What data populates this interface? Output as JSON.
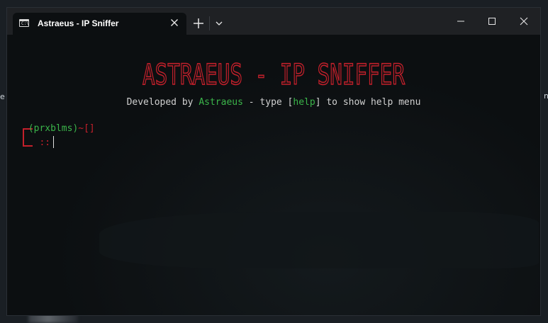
{
  "window": {
    "tab_title": "Astraeus - IP Sniffer",
    "tab_icon": "terminal-icon"
  },
  "terminal": {
    "banner": "ASTRAEUS - IP SNIFFER",
    "subtitle": {
      "part1": "Developed by ",
      "author": "Astraeus",
      "part2": " - type [",
      "help_cmd": "help",
      "part3": "] to show help menu"
    },
    "prompt": {
      "user": "(prxblms)",
      "path": "~[]",
      "input_marker": "::"
    }
  },
  "colors": {
    "accent_red": "#c3202b",
    "accent_green": "#3bb54a",
    "terminal_bg": "#0c0f11",
    "titlebar_bg": "#1f2124"
  },
  "desktop": {
    "left_fragment": "e",
    "right_fragment": "n"
  }
}
